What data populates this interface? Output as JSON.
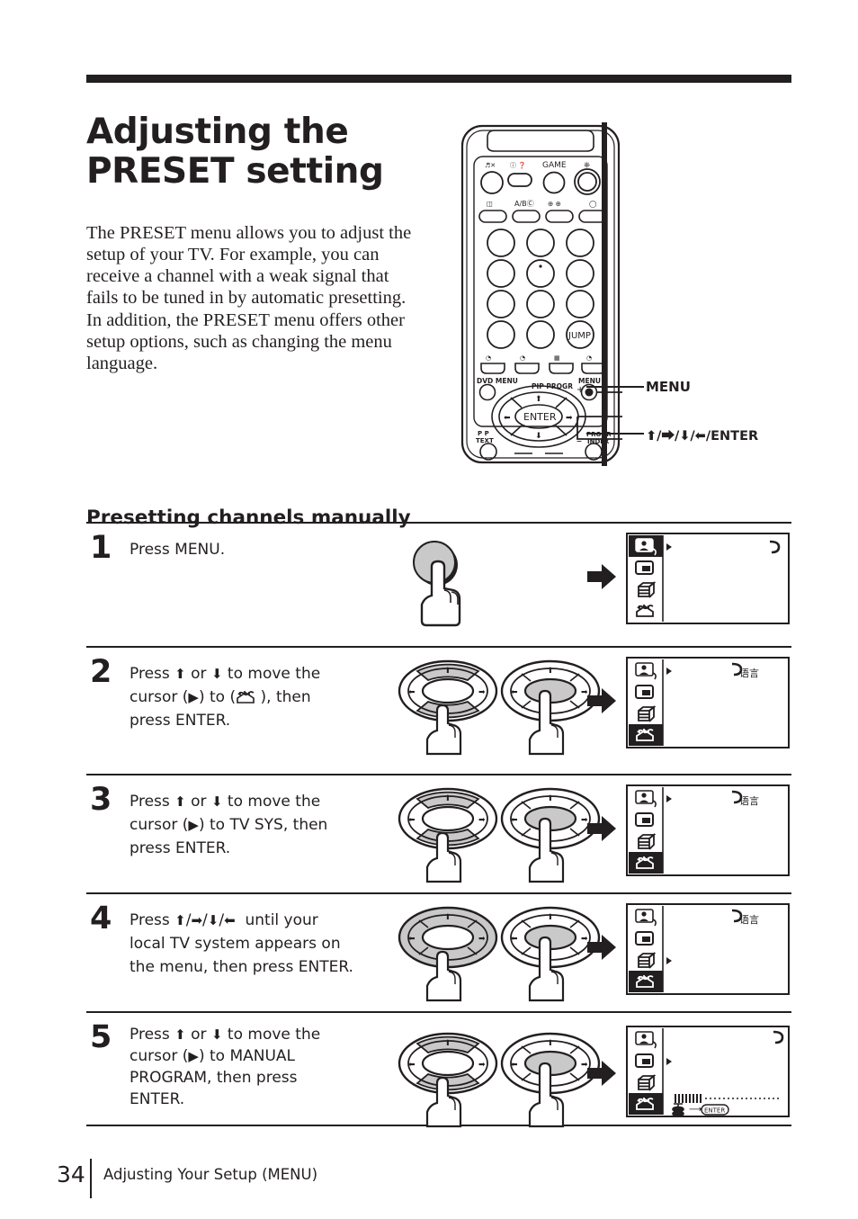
{
  "page": {
    "title_line1": "Adjusting the",
    "title_line2": "PRESET setting",
    "intro": "The PRESET menu allows you to adjust the setup of your TV. For example, you can receive a channel with a weak signal that fails to be tuned in by automatic presetting. In addition, the PRESET menu offers other setup options, such as changing the menu language.",
    "section_heading": "Presetting channels manually"
  },
  "remote": {
    "callout_menu": "MENU",
    "callout_enter": "⬆/⮕/⬇/⬅/ENTER",
    "labels": {
      "game": "GAME",
      "ab": "A/B",
      "jump": "JUMP",
      "dvd_menu": "DVD MENU",
      "pip_progr": "PIP PROGR",
      "menu": "MENU",
      "pip_text_1": "P P",
      "pip_text_2": "TEXT",
      "progr_1": "PROGR",
      "progr_2": "INDEX",
      "enter": "ENTER",
      "plus": "+",
      "minus": "–"
    }
  },
  "steps": [
    {
      "number": "1",
      "text": "Press MENU.",
      "art": "round-button-press",
      "tv": {
        "selected_index": 0,
        "cursor_index": 0,
        "label": "",
        "progress": false
      }
    },
    {
      "number": "2",
      "text_parts": [
        "Press ",
        "⬆",
        " or ",
        "⬇",
        " to move the cursor (",
        "▶",
        ") to (",
        "[icon]",
        " ), then press ENTER."
      ],
      "text": "Press ⬆ or ⬇ to move the cursor (▶) to ( ), then press ENTER.",
      "art": "dpad-updown",
      "tv": {
        "selected_index": 3,
        "cursor_index": 0,
        "label": "语言",
        "progress": false
      }
    },
    {
      "number": "3",
      "text": "Press ⬆ or ⬇ to move the cursor (▶) to TV SYS, then press ENTER.",
      "art": "dpad-updown",
      "tv": {
        "selected_index": 3,
        "cursor_index": 0,
        "label": "语言",
        "progress": false
      }
    },
    {
      "number": "4",
      "text": "Press ⬆/⮕/⬇/⬅  until your local TV system appears on the menu, then press ENTER.",
      "art": "dpad-all",
      "tv": {
        "selected_index": 3,
        "cursor_index": 2,
        "label": "语言",
        "progress": false
      }
    },
    {
      "number": "5",
      "text": "Press ⬆ or ⬇ to move the cursor (▶) to MANUAL PROGRAM, then press ENTER.",
      "art": "dpad-updown",
      "tv": {
        "selected_index": 3,
        "cursor_index": 1,
        "label": "",
        "progress": true,
        "progress_enter_label": "ENTER"
      }
    }
  ],
  "footer": {
    "page_number": "34",
    "section": "Adjusting Your Setup (MENU)"
  },
  "colors": {
    "ink": "#231f20",
    "highlight": "#c9c9c9",
    "paper": "#ffffff"
  }
}
